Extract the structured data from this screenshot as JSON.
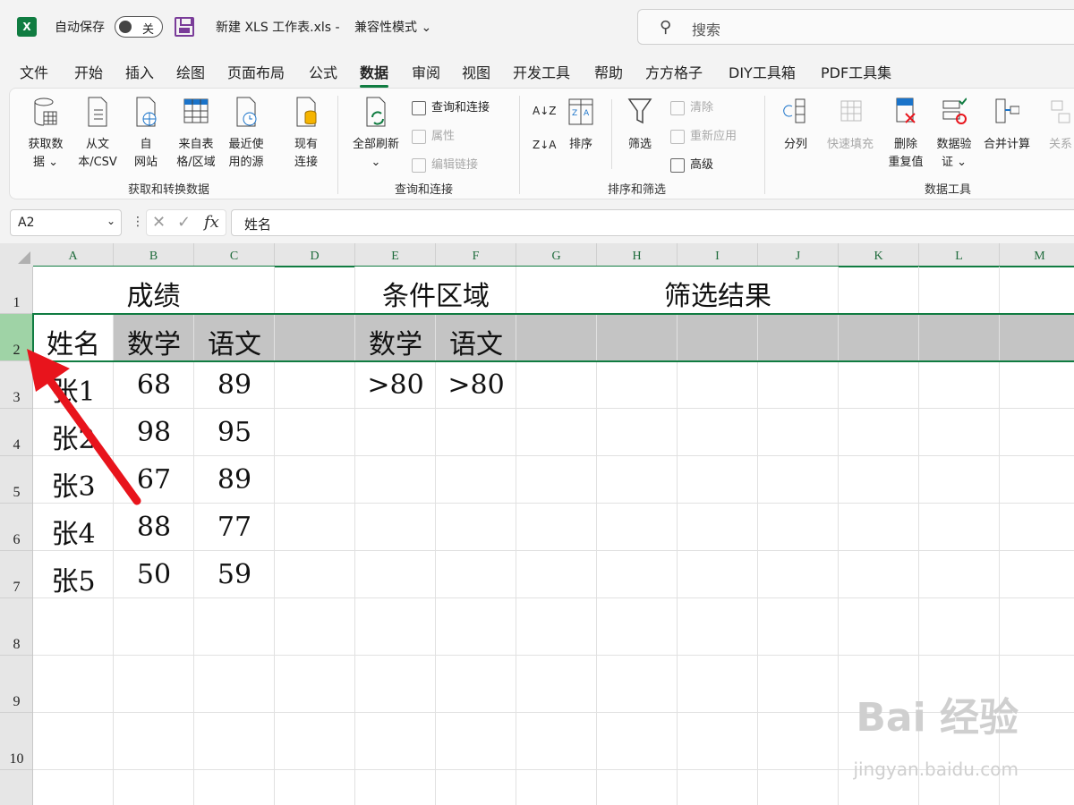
{
  "titlebar": {
    "logo": "X",
    "autosave_label": "自动保存",
    "autosave_state": "关",
    "doc_title": "新建 XLS 工作表.xls  -",
    "mode": "兼容性模式 ⌄",
    "search_placeholder": "搜索"
  },
  "tabs": [
    "文件",
    "开始",
    "插入",
    "绘图",
    "页面布局",
    "公式",
    "数据",
    "审阅",
    "视图",
    "开发工具",
    "帮助",
    "方方格子",
    "DIY工具箱",
    "PDF工具集"
  ],
  "active_tab": "数据",
  "ribbon": {
    "get_data": {
      "l1": "获取数",
      "l2": "据 ⌄"
    },
    "from_csv": {
      "l1": "从文",
      "l2": "本/CSV"
    },
    "from_web": {
      "l1": "自",
      "l2": "网站"
    },
    "from_table": {
      "l1": "来自表",
      "l2": "格/区域"
    },
    "recent": {
      "l1": "最近使",
      "l2": "用的源"
    },
    "existing": {
      "l1": "现有",
      "l2": "连接"
    },
    "group1": "获取和转换数据",
    "refresh_all": {
      "l1": "全部刷新",
      "l2": "⌄"
    },
    "queries": "查询和连接",
    "properties": "属性",
    "edit_links": "编辑链接",
    "group2": "查询和连接",
    "sort_az": "A↓Z",
    "sort_za": "Z↓A",
    "sort": "排序",
    "filter": "筛选",
    "clear": "清除",
    "reapply": "重新应用",
    "advanced": "高级",
    "group3": "排序和筛选",
    "text_to_cols": "分列",
    "flash_fill": "快速填充",
    "remove_dup": {
      "l1": "删除",
      "l2": "重复值"
    },
    "validation": {
      "l1": "数据验",
      "l2": "证 ⌄"
    },
    "consolidate": "合并计算",
    "relations": "关系",
    "group4": "数据工具"
  },
  "formula_bar": {
    "name_box": "A2",
    "cancel": "✕",
    "enter": "✓",
    "fx": "fx",
    "content": "姓名"
  },
  "columns": [
    "A",
    "B",
    "C",
    "D",
    "E",
    "F",
    "G",
    "H",
    "I",
    "J",
    "K",
    "L",
    "M"
  ],
  "rows": [
    "1",
    "2",
    "3",
    "4",
    "5",
    "6",
    "7",
    "8",
    "9",
    "10"
  ],
  "cells": {
    "title_score": "成绩",
    "title_criteria": "条件区域",
    "title_result": "筛选结果",
    "h_name": "姓名",
    "h_math": "数学",
    "h_chinese": "语文",
    "c_math": "数学",
    "c_chinese": "语文",
    "c_math_val": ">80",
    "c_chinese_val": ">80",
    "data": [
      [
        "张1",
        "68",
        "89"
      ],
      [
        "张2",
        "98",
        "95"
      ],
      [
        "张3",
        "67",
        "89"
      ],
      [
        "张4",
        "88",
        "77"
      ],
      [
        "张5",
        "50",
        "59"
      ]
    ]
  },
  "watermark": {
    "main": "Bai 经验",
    "sub": "jingyan.baidu.com"
  },
  "colors": {
    "accent": "#107c41",
    "arrow": "#e8141c",
    "selected_row": "#c4c4c4"
  }
}
